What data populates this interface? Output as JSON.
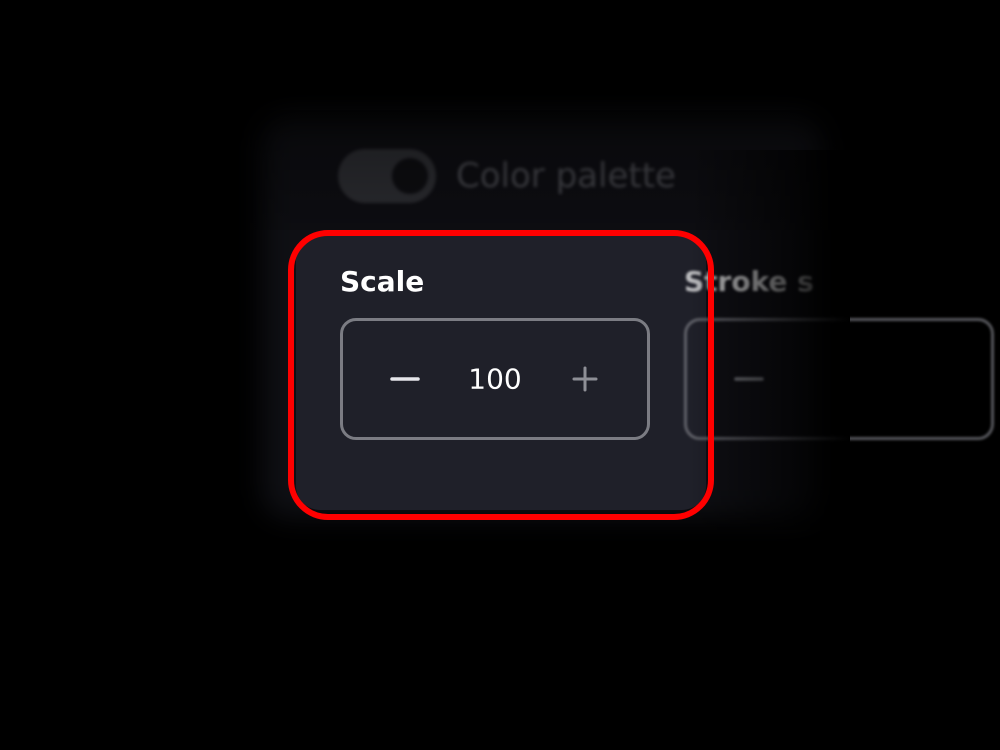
{
  "settings": {
    "toggle": {
      "label": "Color palette",
      "state": "on"
    },
    "scale": {
      "label": "Scale",
      "value": "100",
      "decrement_icon": "minus-icon",
      "increment_icon": "plus-icon"
    },
    "stroke": {
      "label": "Stroke s",
      "decrement_icon": "minus-icon"
    }
  },
  "colors": {
    "background": "#000000",
    "panel": "#1f2029",
    "stepper_border": "#7b7c83",
    "highlight": "#ff0000",
    "text": "#ffffff"
  }
}
